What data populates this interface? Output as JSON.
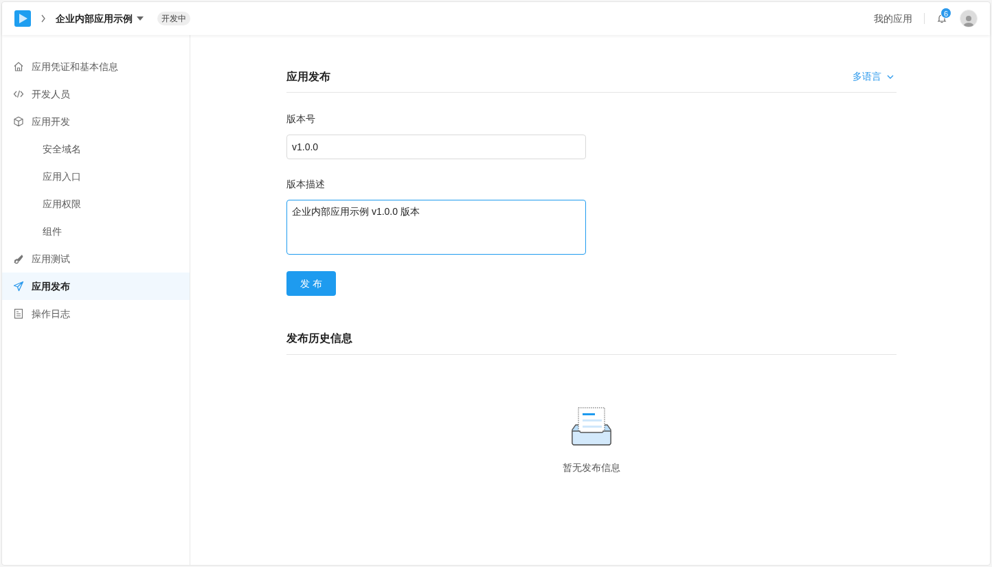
{
  "header": {
    "app_name": "企业内部应用示例",
    "status_badge": "开发中",
    "my_apps_link": "我的应用",
    "notification_count": "6"
  },
  "sidebar": {
    "items": [
      {
        "label": "应用凭证和基本信息",
        "kind": "main",
        "selected": false
      },
      {
        "label": "开发人员",
        "kind": "main",
        "selected": false
      },
      {
        "label": "应用开发",
        "kind": "main",
        "selected": false
      },
      {
        "label": "安全域名",
        "kind": "sub",
        "selected": false
      },
      {
        "label": "应用入口",
        "kind": "sub",
        "selected": false
      },
      {
        "label": "应用权限",
        "kind": "sub",
        "selected": false
      },
      {
        "label": "组件",
        "kind": "sub",
        "selected": false
      },
      {
        "label": "应用测试",
        "kind": "main",
        "selected": false
      },
      {
        "label": "应用发布",
        "kind": "main",
        "selected": true
      },
      {
        "label": "操作日志",
        "kind": "main",
        "selected": false
      }
    ]
  },
  "publish": {
    "title": "应用发布",
    "language_menu": "多语言",
    "version_label": "版本号",
    "version_value": "v1.0.0",
    "description_label": "版本描述",
    "description_value": "企业内部应用示例 v1.0.0 版本",
    "description_focused": true,
    "publish_button": "发 布"
  },
  "history": {
    "title": "发布历史信息",
    "empty_text": "暂无发布信息"
  }
}
